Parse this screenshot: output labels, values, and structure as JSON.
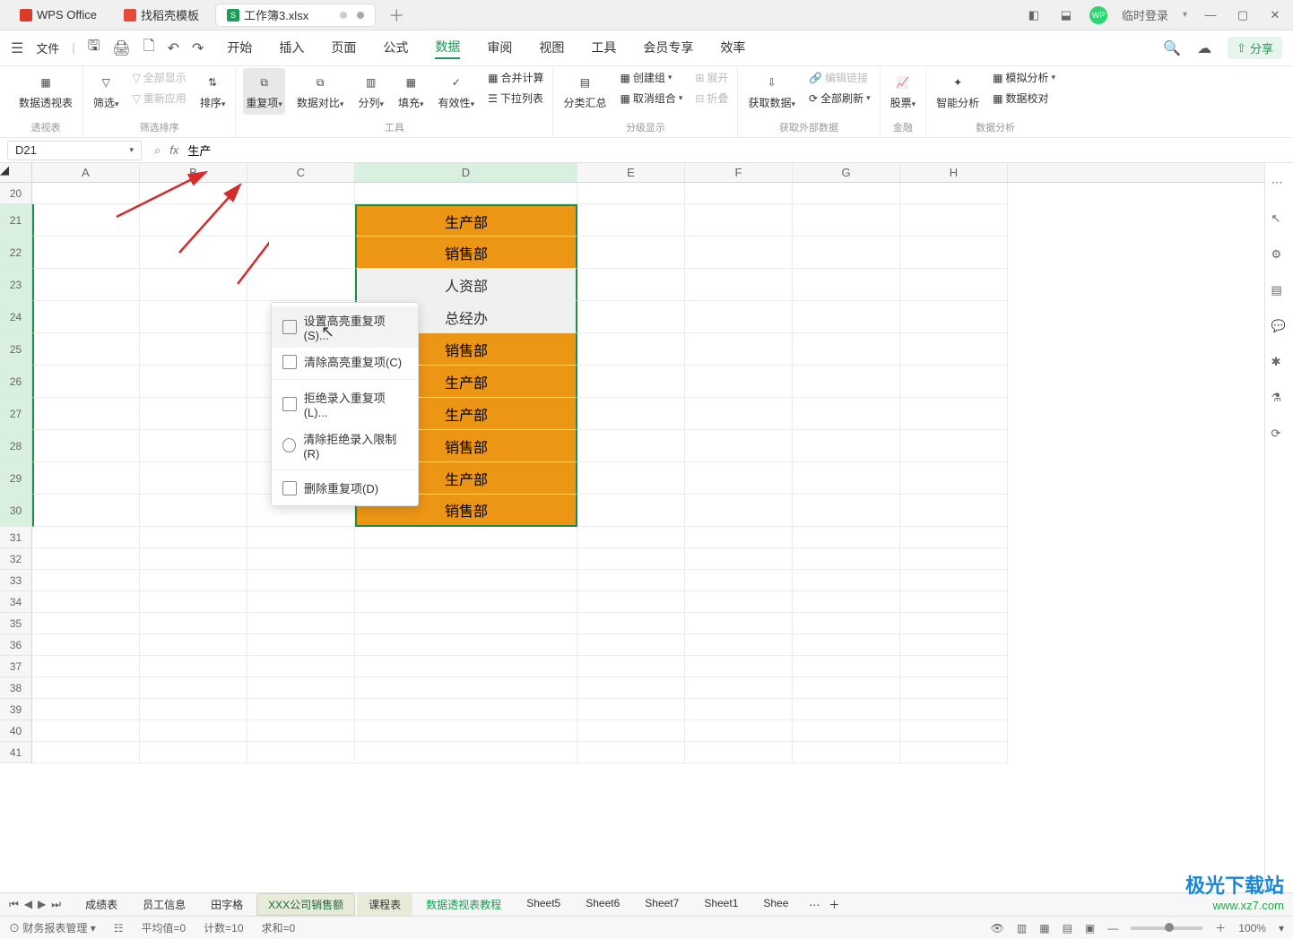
{
  "titlebar": {
    "app_name": "WPS Office",
    "template_tab": "找稻壳模板",
    "doc_tab": "工作簿3.xlsx",
    "login_text": "临时登录"
  },
  "menu": {
    "file": "文件",
    "tabs": [
      "开始",
      "插入",
      "页面",
      "公式",
      "数据",
      "审阅",
      "视图",
      "工具",
      "会员专享",
      "效率"
    ],
    "active_index": 4,
    "share": "分享"
  },
  "ribbon": {
    "pivot": "数据透视表",
    "pivot_group": "透视表",
    "filter": "筛选",
    "show_all": "全部显示",
    "reapply": "重新应用",
    "filter_group": "筛选排序",
    "sort": "排序",
    "duplicate": "重复项",
    "compare": "数据对比",
    "split_col": "分列",
    "fill": "填充",
    "validity": "有效性",
    "merge_calc": "合并计算",
    "dropdown_list": "下拉列表",
    "tools_group": "工具",
    "subtotal": "分类汇总",
    "group_create": "创建组",
    "ungroup": "取消组合",
    "expand": "展开",
    "collapse": "折叠",
    "group_group": "分级显示",
    "fetch_data": "获取数据",
    "edit_link": "编辑链接",
    "refresh_all": "全部刷新",
    "external_group": "获取外部数据",
    "stock": "股票",
    "finance_group": "金融",
    "smart_analysis": "智能分析",
    "simulate": "模拟分析",
    "data_validation": "数据校对",
    "analysis_group": "数据分析"
  },
  "dropdown": {
    "set_highlight": "设置高亮重复项(S)...",
    "clear_highlight": "清除高亮重复项(C)",
    "reject_input": "拒绝录入重复项(L)...",
    "clear_reject": "清除拒绝录入限制(R)",
    "remove_dup": "删除重复项(D)"
  },
  "formula_bar": {
    "cell_ref": "D21",
    "value": "生产"
  },
  "columns": [
    "A",
    "B",
    "C",
    "D",
    "E",
    "F",
    "G",
    "H"
  ],
  "rows_start": 20,
  "rows_end": 41,
  "data_cells": {
    "21": {
      "text": "生产部",
      "hl": true
    },
    "22": {
      "text": "销售部",
      "hl": true
    },
    "23": {
      "text": "人资部",
      "hl": false
    },
    "24": {
      "text": "总经办",
      "hl": false
    },
    "25": {
      "text": "销售部",
      "hl": true
    },
    "26": {
      "text": "生产部",
      "hl": true
    },
    "27": {
      "text": "生产部",
      "hl": true
    },
    "28": {
      "text": "销售部",
      "hl": true
    },
    "29": {
      "text": "生产部",
      "hl": true
    },
    "30": {
      "text": "销售部",
      "hl": true
    }
  },
  "sheets": [
    "成绩表",
    "员工信息",
    "田字格",
    "XXX公司销售额",
    "课程表",
    "数据透视表教程",
    "Sheet5",
    "Sheet6",
    "Sheet7",
    "Sheet1",
    "Shee"
  ],
  "sheets_active_index": 3,
  "status": {
    "left1": "财务报表管理",
    "avg": "平均值=0",
    "count": "计数=10",
    "sum": "求和=0",
    "zoom": "100%"
  },
  "colors": {
    "highlight": "#ed9515",
    "accent_green": "#1b9c52"
  },
  "watermark": {
    "big": "极光下载站",
    "small": "www.xz7.com"
  }
}
